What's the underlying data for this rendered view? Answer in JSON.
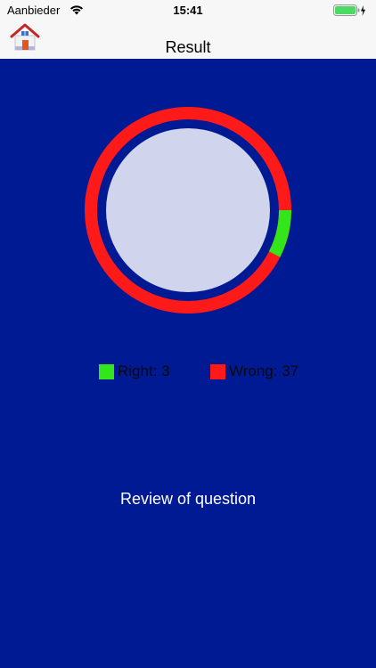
{
  "status_bar": {
    "carrier": "Aanbieder",
    "time": "15:41"
  },
  "nav": {
    "title": "Result",
    "home_icon": "house-icon"
  },
  "result": {
    "right_count": 3,
    "wrong_count": 37,
    "right_label": "Right: 3",
    "wrong_label": "Wrong: 37",
    "colors": {
      "right": "#33e61a",
      "wrong": "#ff1a1a",
      "background": "#001a94",
      "inner_circle": "#d0d4ec"
    }
  },
  "review_button": {
    "label": "Review of question"
  }
}
